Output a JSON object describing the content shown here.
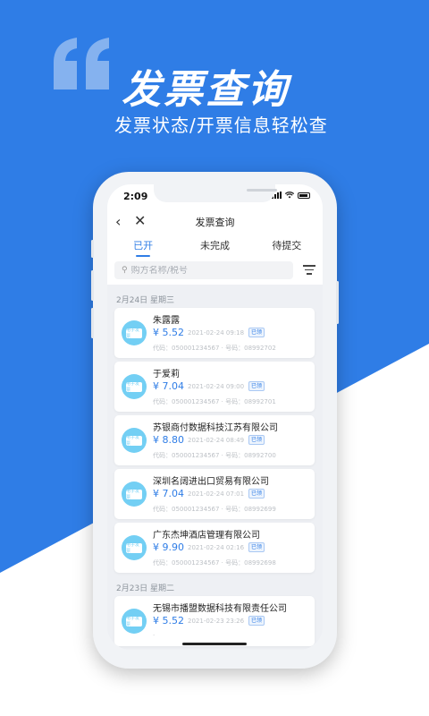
{
  "banner": {
    "headline": "发票查询",
    "subline": "发票状态/开票信息轻松查",
    "quote_glyph": "❝"
  },
  "colors": {
    "brand_blue": "#2f7de6",
    "icon_cyan": "#73cff4"
  },
  "status_bar": {
    "time": "2:09"
  },
  "nav": {
    "back_icon": "chevron-left-icon",
    "close_icon": "close-icon",
    "back_glyph": "‹",
    "close_glyph": "✕",
    "title": "发票查询"
  },
  "tabs": [
    {
      "label": "已开",
      "active": true
    },
    {
      "label": "未完成",
      "active": false
    },
    {
      "label": "待提交",
      "active": false
    }
  ],
  "search": {
    "placeholder": "购方名称/税号",
    "icon": "search-icon",
    "glyph": "⚲"
  },
  "groups": [
    {
      "date": "2月24日 星期三",
      "items": [
        {
          "name": "朱露露",
          "amount": "¥ 5.52",
          "datetime": "2021-02-24 09:18",
          "status": "已领",
          "code": "代码：050001234567",
          "number": "号码：08992702"
        },
        {
          "name": "于爱莉",
          "amount": "¥ 7.04",
          "datetime": "2021-02-24 09:00",
          "status": "已领",
          "code": "代码：050001234567",
          "number": "号码：08992701"
        },
        {
          "name": "苏银商付数据科技江苏有限公司",
          "amount": "¥ 8.80",
          "datetime": "2021-02-24 08:49",
          "status": "已领",
          "code": "代码：050001234567",
          "number": "号码：08992700"
        },
        {
          "name": "深圳名阔进出口贸易有限公司",
          "amount": "¥ 7.04",
          "datetime": "2021-02-24 07:01",
          "status": "已领",
          "code": "代码：050001234567",
          "number": "号码：08992699"
        },
        {
          "name": "广东杰坤酒店管理有限公司",
          "amount": "¥ 9.90",
          "datetime": "2021-02-24 02:16",
          "status": "已领",
          "code": "代码：050001234567",
          "number": "号码：08992698"
        }
      ]
    },
    {
      "date": "2月23日 星期二",
      "items": [
        {
          "name": "无锡市播盟数据科技有限责任公司",
          "amount": "¥ 5.52",
          "datetime": "2021-02-23 23:26",
          "status": "已领",
          "code": "",
          "number": ""
        }
      ]
    }
  ],
  "ticket_icon_text": "电子发票"
}
